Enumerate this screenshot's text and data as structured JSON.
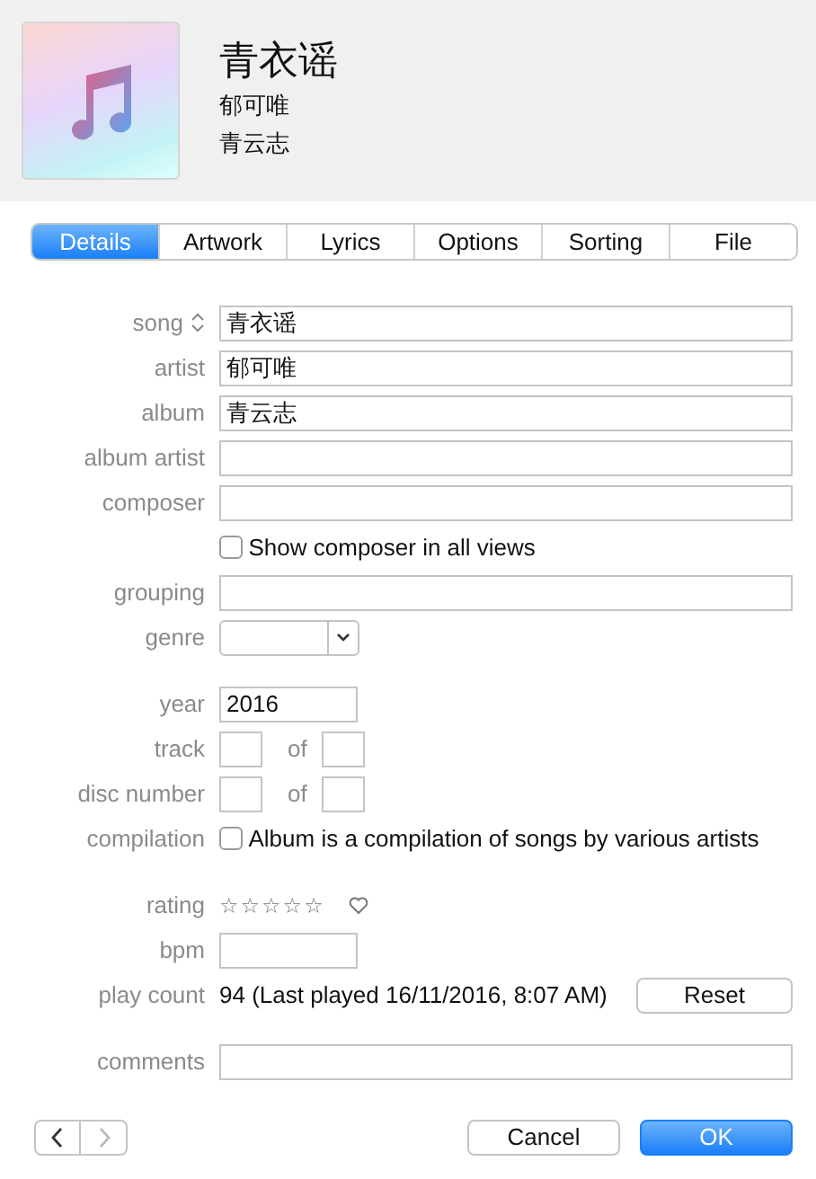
{
  "header": {
    "title": "青衣谣",
    "artist": "郁可唯",
    "album": "青云志"
  },
  "tabs": [
    {
      "label": "Details",
      "selected": true
    },
    {
      "label": "Artwork",
      "selected": false
    },
    {
      "label": "Lyrics",
      "selected": false
    },
    {
      "label": "Options",
      "selected": false
    },
    {
      "label": "Sorting",
      "selected": false
    },
    {
      "label": "File",
      "selected": false
    }
  ],
  "sections": [
    [
      {
        "kind": "text",
        "label": "song",
        "sortable": true,
        "value": "青衣谣"
      },
      {
        "kind": "text",
        "label": "artist",
        "value": "郁可唯"
      },
      {
        "kind": "text",
        "label": "album",
        "value": "青云志"
      },
      {
        "kind": "text",
        "label": "album artist"
      },
      {
        "kind": "text",
        "label": "composer"
      },
      {
        "kind": "check",
        "text": "Show composer in all views",
        "checked": false
      },
      {
        "kind": "text",
        "label": "grouping"
      },
      {
        "kind": "select",
        "label": "genre"
      }
    ],
    [
      {
        "kind": "short",
        "label": "year",
        "value": "2016"
      },
      {
        "kind": "pair",
        "label": "track",
        "of": "of"
      },
      {
        "kind": "pair",
        "label": "disc number",
        "of": "of"
      },
      {
        "kind": "check",
        "label": "compilation",
        "text": "Album is a compilation of songs by various artists",
        "checked": false
      }
    ],
    [
      {
        "kind": "rating",
        "label": "rating",
        "stars": 0,
        "loved": false
      },
      {
        "kind": "short",
        "label": "bpm"
      },
      {
        "kind": "count",
        "label": "play count",
        "value": "94 (Last played 16/11/2016, 8:07 AM)",
        "button": "Reset"
      }
    ],
    [
      {
        "kind": "text",
        "label": "comments"
      }
    ]
  ],
  "nav": [
    {
      "disabled": false
    },
    {
      "disabled": true
    }
  ],
  "buttons": [
    {
      "label": "Cancel",
      "kind": "default"
    },
    {
      "label": "OK",
      "kind": "primary"
    }
  ]
}
